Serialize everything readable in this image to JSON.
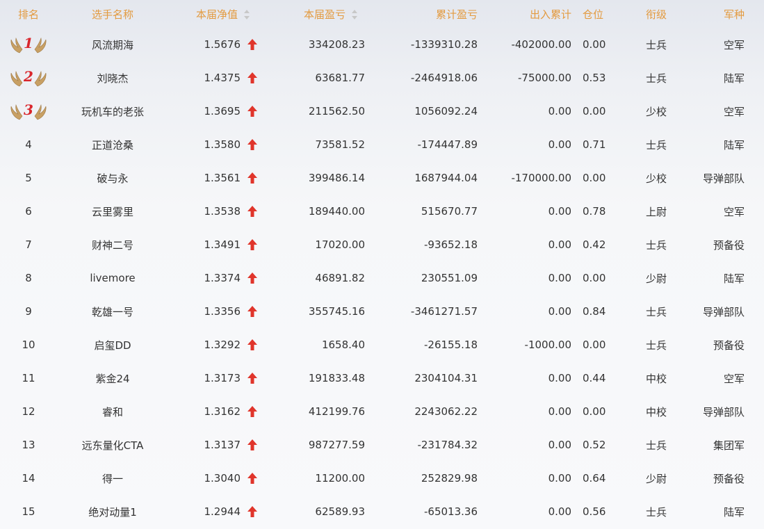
{
  "headers": {
    "rank": "排名",
    "name": "选手名称",
    "net_value": "本届净值",
    "pnl": "本届盈亏",
    "cum_pnl": "累计盈亏",
    "flow": "出入累计",
    "position": "仓位",
    "level": "衔级",
    "arm": "军种"
  },
  "icons": {
    "sort": "sort-icon",
    "up": "up-arrow-icon",
    "medal": "laurel-medal-icon"
  },
  "colors": {
    "header_text": "#e39a3f",
    "up_arrow": "#e0352b",
    "medal_number": "#d9262c",
    "medal_wing": "#c8a064"
  },
  "rows": [
    {
      "rank": "1",
      "name": "风流期海",
      "net_value": "1.5676",
      "pnl": "334208.23",
      "cum_pnl": "-1339310.28",
      "flow": "-402000.00",
      "position": "0.00",
      "level": "士兵",
      "arm": "空军"
    },
    {
      "rank": "2",
      "name": "刘晓杰",
      "net_value": "1.4375",
      "pnl": "63681.77",
      "cum_pnl": "-2464918.06",
      "flow": "-75000.00",
      "position": "0.53",
      "level": "士兵",
      "arm": "陆军"
    },
    {
      "rank": "3",
      "name": "玩机车的老张",
      "net_value": "1.3695",
      "pnl": "211562.50",
      "cum_pnl": "1056092.24",
      "flow": "0.00",
      "position": "0.00",
      "level": "少校",
      "arm": "空军"
    },
    {
      "rank": "4",
      "name": "正道沧桑",
      "net_value": "1.3580",
      "pnl": "73581.52",
      "cum_pnl": "-174447.89",
      "flow": "0.00",
      "position": "0.71",
      "level": "士兵",
      "arm": "陆军"
    },
    {
      "rank": "5",
      "name": "破与永",
      "net_value": "1.3561",
      "pnl": "399486.14",
      "cum_pnl": "1687944.04",
      "flow": "-170000.00",
      "position": "0.00",
      "level": "少校",
      "arm": "导弹部队"
    },
    {
      "rank": "6",
      "name": "云里雾里",
      "net_value": "1.3538",
      "pnl": "189440.00",
      "cum_pnl": "515670.77",
      "flow": "0.00",
      "position": "0.78",
      "level": "上尉",
      "arm": "空军"
    },
    {
      "rank": "7",
      "name": "财神二号",
      "net_value": "1.3491",
      "pnl": "17020.00",
      "cum_pnl": "-93652.18",
      "flow": "0.00",
      "position": "0.42",
      "level": "士兵",
      "arm": "预备役"
    },
    {
      "rank": "8",
      "name": "livemore",
      "net_value": "1.3374",
      "pnl": "46891.82",
      "cum_pnl": "230551.09",
      "flow": "0.00",
      "position": "0.00",
      "level": "少尉",
      "arm": "陆军"
    },
    {
      "rank": "9",
      "name": "乾雄一号",
      "net_value": "1.3356",
      "pnl": "355745.16",
      "cum_pnl": "-3461271.57",
      "flow": "0.00",
      "position": "0.84",
      "level": "士兵",
      "arm": "导弹部队"
    },
    {
      "rank": "10",
      "name": "启玺DD",
      "net_value": "1.3292",
      "pnl": "1658.40",
      "cum_pnl": "-26155.18",
      "flow": "-1000.00",
      "position": "0.00",
      "level": "士兵",
      "arm": "预备役"
    },
    {
      "rank": "11",
      "name": "紫金24",
      "net_value": "1.3173",
      "pnl": "191833.48",
      "cum_pnl": "2304104.31",
      "flow": "0.00",
      "position": "0.44",
      "level": "中校",
      "arm": "空军"
    },
    {
      "rank": "12",
      "name": "睿和",
      "net_value": "1.3162",
      "pnl": "412199.76",
      "cum_pnl": "2243062.22",
      "flow": "0.00",
      "position": "0.00",
      "level": "中校",
      "arm": "导弹部队"
    },
    {
      "rank": "13",
      "name": "远东量化CTA",
      "net_value": "1.3137",
      "pnl": "987277.59",
      "cum_pnl": "-231784.32",
      "flow": "0.00",
      "position": "0.52",
      "level": "士兵",
      "arm": "集团军"
    },
    {
      "rank": "14",
      "name": "得一",
      "net_value": "1.3040",
      "pnl": "11200.00",
      "cum_pnl": "252829.98",
      "flow": "0.00",
      "position": "0.64",
      "level": "少尉",
      "arm": "预备役"
    },
    {
      "rank": "15",
      "name": "绝对动量1",
      "net_value": "1.2944",
      "pnl": "62589.93",
      "cum_pnl": "-65013.36",
      "flow": "0.00",
      "position": "0.56",
      "level": "士兵",
      "arm": "陆军"
    }
  ]
}
